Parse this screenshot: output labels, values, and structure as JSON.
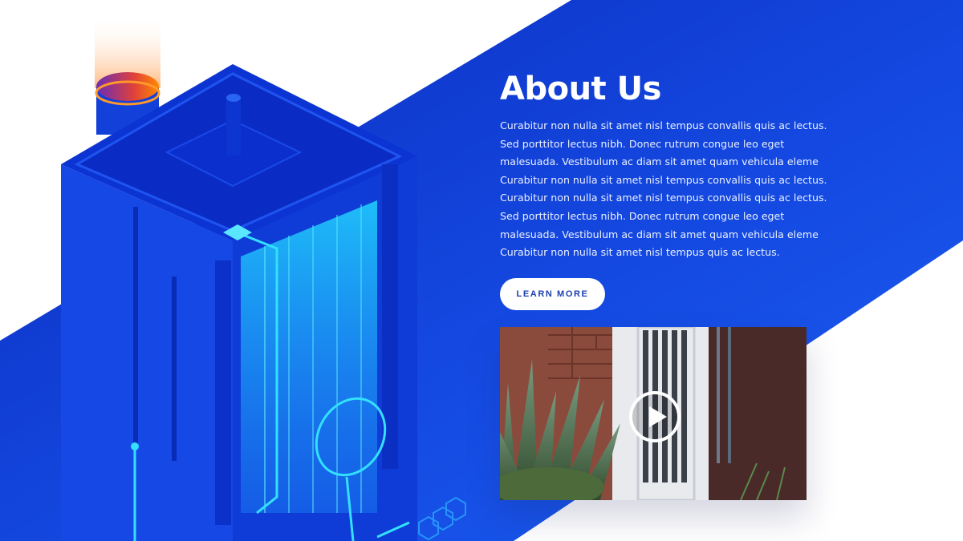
{
  "about": {
    "title": "About Us",
    "body": "Curabitur non nulla sit amet nisl tempus convallis quis ac lectus. Sed porttitor lectus nibh. Donec rutrum congue leo eget malesuada. Vestibulum ac diam sit amet quam vehicula eleme Curabitur non nulla sit amet nisl tempus convallis quis ac lectus.  Curabitur non nulla sit amet nisl tempus convallis quis ac lectus. Sed porttitor lectus nibh. Donec rutrum congue leo eget malesuada. Vestibulum ac diam sit amet quam vehicula eleme Curabitur non nulla sit amet nisl tempus quis ac lectus.",
    "button_label": "LEARN MORE"
  },
  "video": {
    "play_icon": "play-icon"
  },
  "colors": {
    "band_blue": "#0a2fc8",
    "band_light": "#1f5cf0",
    "accent_cyan": "#34d8ff",
    "cylinder_orange": "#ff8a00",
    "button_text": "#1b3fb0"
  }
}
